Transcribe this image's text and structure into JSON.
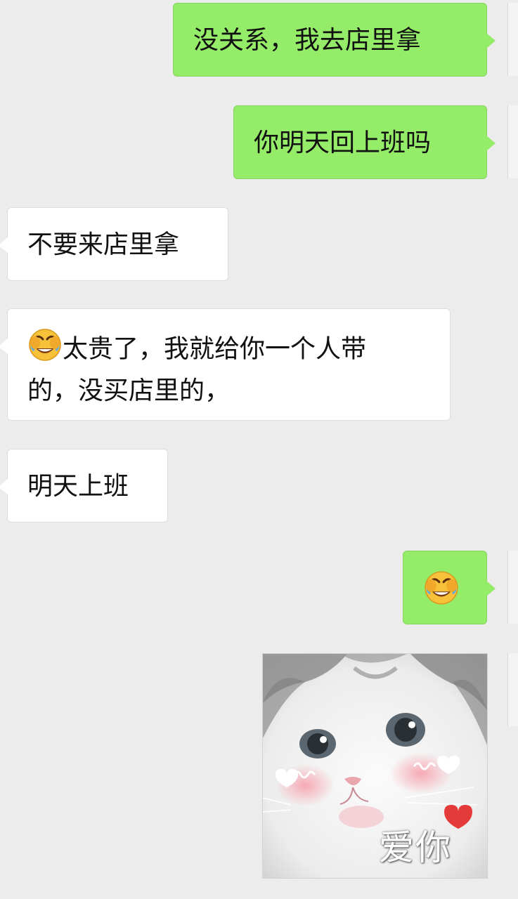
{
  "messages": [
    {
      "side": "out",
      "text": "没关系，我去店里拿"
    },
    {
      "side": "out",
      "text": "你明天回上班吗"
    },
    {
      "side": "in",
      "text": "不要来店里拿"
    },
    {
      "side": "in",
      "emoji": "face-with-tears-of-joy-icon",
      "line1": "太贵了，我就给你一个人带",
      "line2": "的，没买店里的，"
    },
    {
      "side": "in",
      "text": "明天上班"
    },
    {
      "side": "out",
      "emoji": "face-with-tears-of-joy-icon"
    },
    {
      "side": "out",
      "sticker": "crying-cat-sticker",
      "caption": "爱你"
    }
  ],
  "colors": {
    "background": "#ececec",
    "outgoing_bubble": "#95ec69",
    "incoming_bubble": "#ffffff"
  }
}
